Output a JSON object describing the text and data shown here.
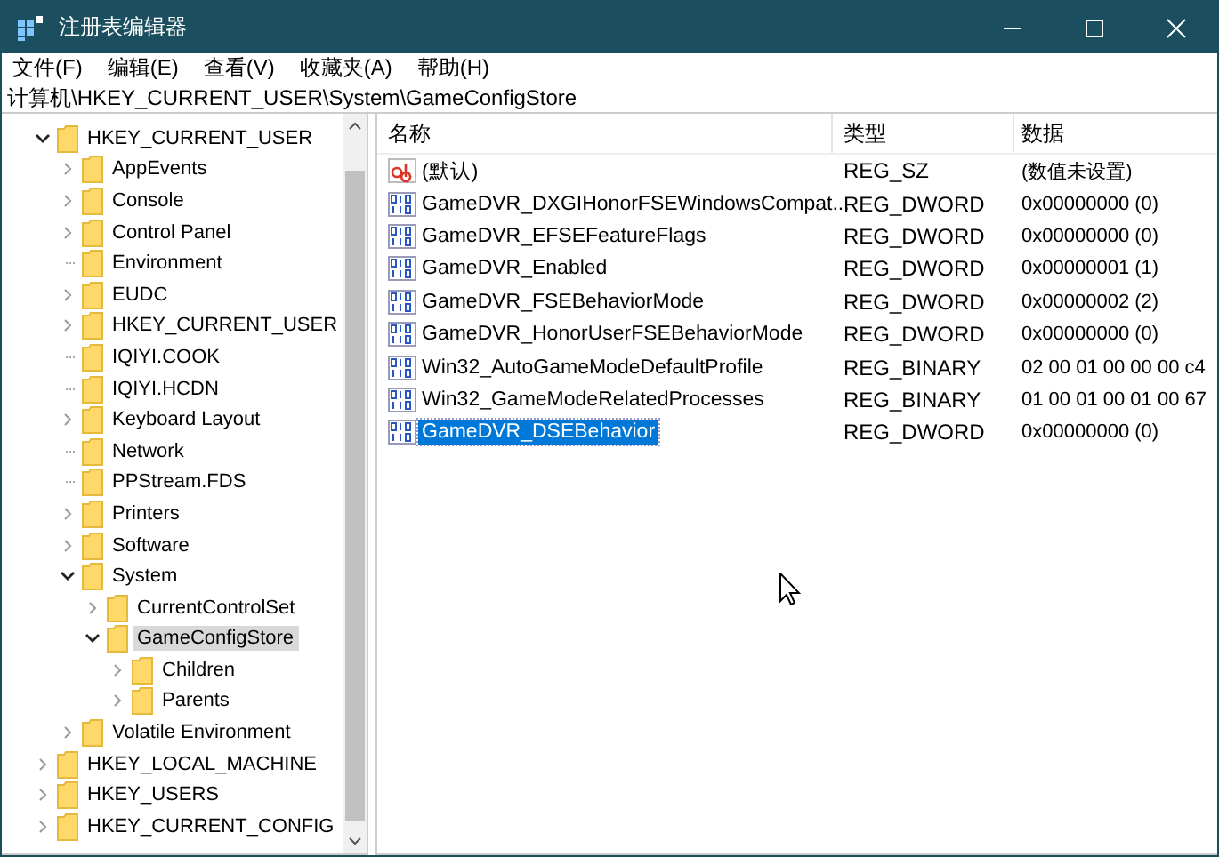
{
  "window": {
    "title": "注册表编辑器"
  },
  "menu": [
    "文件(F)",
    "编辑(E)",
    "查看(V)",
    "收藏夹(A)",
    "帮助(H)"
  ],
  "address": "计算机\\HKEY_CURRENT_USER\\System\\GameConfigStore",
  "tree": [
    {
      "label": "HKEY_CURRENT_USER",
      "expanded": true,
      "selected": false,
      "children": [
        {
          "label": "AppEvents",
          "expanded": false,
          "selected": false
        },
        {
          "label": "Console",
          "expanded": false,
          "selected": false
        },
        {
          "label": "Control Panel",
          "expanded": false,
          "selected": false
        },
        {
          "label": "Environment",
          "selected": false
        },
        {
          "label": "EUDC",
          "expanded": false,
          "selected": false
        },
        {
          "label": "HKEY_CURRENT_USER",
          "expanded": false,
          "selected": false
        },
        {
          "label": "IQIYI.COOK",
          "selected": false
        },
        {
          "label": "IQIYI.HCDN",
          "selected": false
        },
        {
          "label": "Keyboard Layout",
          "expanded": false,
          "selected": false
        },
        {
          "label": "Network",
          "selected": false
        },
        {
          "label": "PPStream.FDS",
          "selected": false
        },
        {
          "label": "Printers",
          "expanded": false,
          "selected": false
        },
        {
          "label": "Software",
          "expanded": false,
          "selected": false
        },
        {
          "label": "System",
          "expanded": true,
          "selected": false,
          "children": [
            {
              "label": "CurrentControlSet",
              "expanded": false,
              "selected": false
            },
            {
              "label": "GameConfigStore",
              "expanded": true,
              "selected": true,
              "children": [
                {
                  "label": "Children",
                  "expanded": false,
                  "selected": false
                },
                {
                  "label": "Parents",
                  "expanded": false,
                  "selected": false
                }
              ]
            }
          ]
        },
        {
          "label": "Volatile Environment",
          "expanded": false,
          "selected": false
        }
      ]
    },
    {
      "label": "HKEY_LOCAL_MACHINE",
      "expanded": false,
      "selected": false
    },
    {
      "label": "HKEY_USERS",
      "expanded": false,
      "selected": false
    },
    {
      "label": "HKEY_CURRENT_CONFIG",
      "expanded": false,
      "selected": false
    }
  ],
  "table": {
    "columns": [
      "名称",
      "类型",
      "数据"
    ],
    "rows": [
      {
        "kind": "string",
        "name": "(默认)",
        "type": "REG_SZ",
        "data": "(数值未设置)",
        "selected": false
      },
      {
        "kind": "binary",
        "name": "GameDVR_DXGIHonorFSEWindowsCompat...",
        "type": "REG_DWORD",
        "data": "0x00000000 (0)",
        "selected": false
      },
      {
        "kind": "binary",
        "name": "GameDVR_EFSEFeatureFlags",
        "type": "REG_DWORD",
        "data": "0x00000000 (0)",
        "selected": false
      },
      {
        "kind": "binary",
        "name": "GameDVR_Enabled",
        "type": "REG_DWORD",
        "data": "0x00000001 (1)",
        "selected": false
      },
      {
        "kind": "binary",
        "name": "GameDVR_FSEBehaviorMode",
        "type": "REG_DWORD",
        "data": "0x00000002 (2)",
        "selected": false
      },
      {
        "kind": "binary",
        "name": "GameDVR_HonorUserFSEBehaviorMode",
        "type": "REG_DWORD",
        "data": "0x00000000 (0)",
        "selected": false
      },
      {
        "kind": "binary",
        "name": "Win32_AutoGameModeDefaultProfile",
        "type": "REG_BINARY",
        "data": "02 00 01 00 00 00 c4",
        "selected": false
      },
      {
        "kind": "binary",
        "name": "Win32_GameModeRelatedProcesses",
        "type": "REG_BINARY",
        "data": "01 00 01 00 01 00 67",
        "selected": false
      },
      {
        "kind": "binary",
        "name": "GameDVR_DSEBehavior",
        "type": "REG_DWORD",
        "data": "0x00000000 (0)",
        "selected": true
      }
    ]
  }
}
